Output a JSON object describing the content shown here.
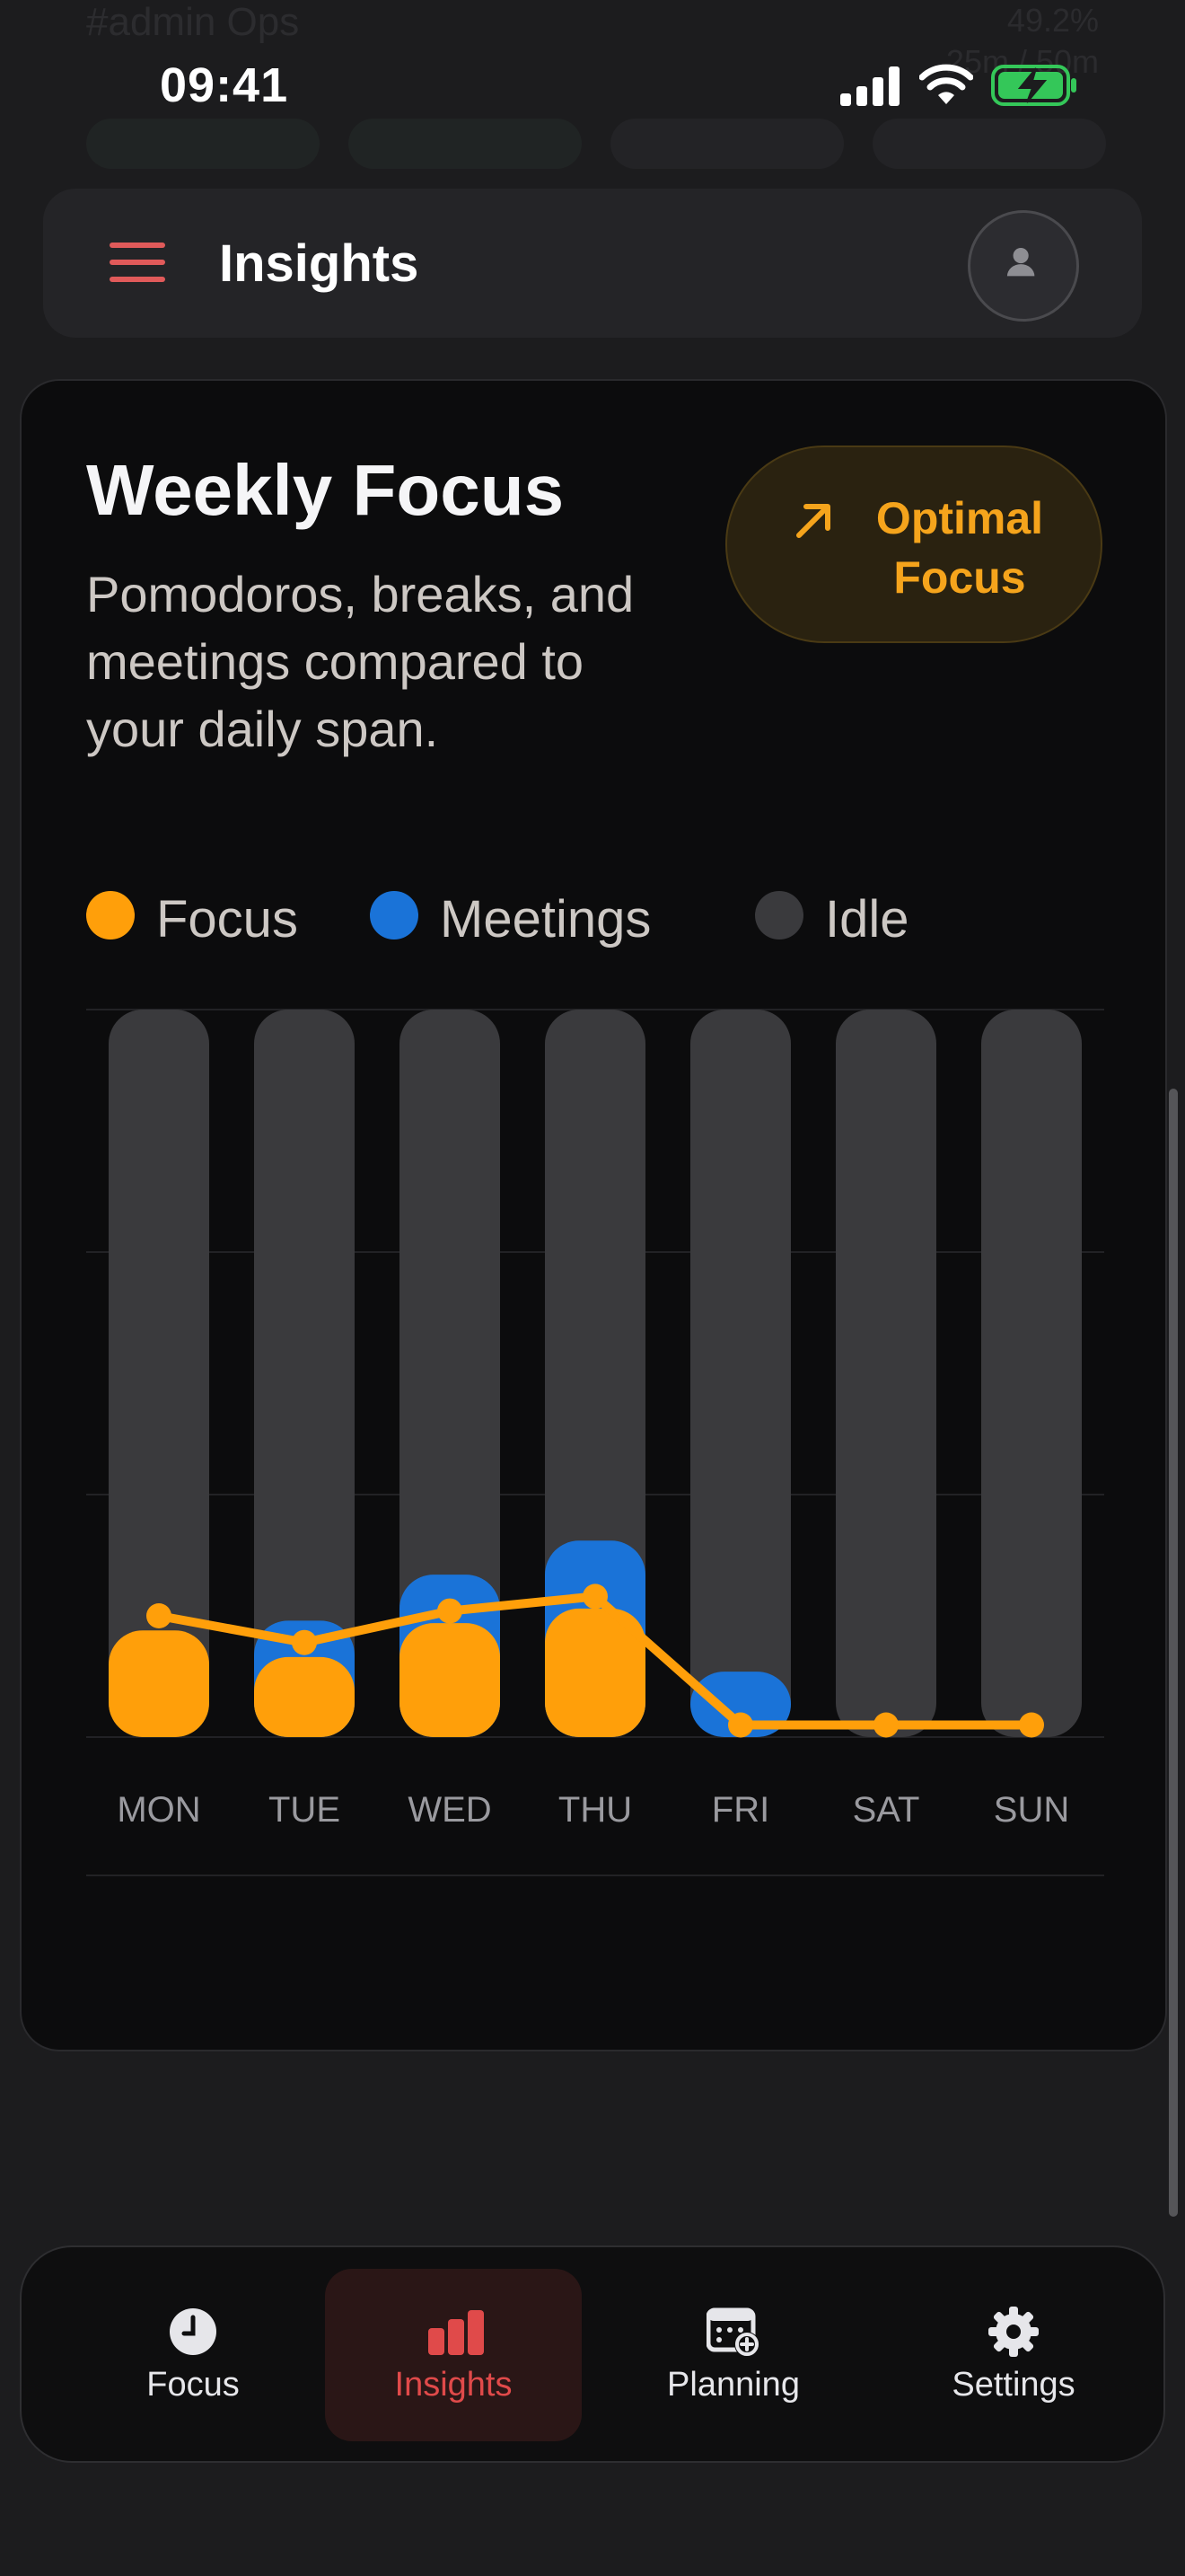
{
  "status_bar": {
    "time": "09:41"
  },
  "ghost": {
    "title": "#admin Ops",
    "meta_top": "49.2%",
    "meta_bottom": "25m / 50m"
  },
  "header": {
    "title": "Insights",
    "menu_icon": "hamburger-icon",
    "avatar_icon": "person-icon"
  },
  "card": {
    "title": "Weekly Focus",
    "subtitle": "Pomodoros, breaks, and meetings compared to your daily span.",
    "action_label": "Optimal Focus",
    "action_icon": "arrow-up-right-icon"
  },
  "legend": [
    {
      "label": "Focus",
      "color": "#ff9f0a"
    },
    {
      "label": "Meetings",
      "color": "#1a73d8"
    },
    {
      "label": "Idle",
      "color": "#3a3a3d"
    }
  ],
  "chart_data": {
    "type": "bar",
    "title": "",
    "categories": [
      "MON",
      "TUE",
      "WED",
      "THU",
      "FRI",
      "SAT",
      "SUN"
    ],
    "stacked": true,
    "ylim": [
      0,
      3
    ],
    "grid": true,
    "legend_position": "top-left",
    "series": [
      {
        "name": "Focus",
        "values": [
          0.44,
          0.33,
          0.47,
          0.53,
          0,
          0,
          0
        ]
      },
      {
        "name": "Meetings",
        "values": [
          0,
          0.15,
          0.2,
          0.28,
          0.27,
          0,
          0
        ]
      },
      {
        "name": "Idle",
        "values": [
          2.56,
          2.52,
          2.33,
          2.19,
          2.73,
          3,
          3
        ]
      }
    ],
    "line": {
      "name": "Focus",
      "values": [
        0.5,
        0.39,
        0.52,
        0.58,
        0.05,
        0.05,
        0.05
      ]
    },
    "colors": {
      "focus": "#ff9f0a",
      "meetings": "#1a73d8",
      "idle": "#3a3a3d",
      "line": "#ff9f0a"
    }
  },
  "nav": [
    {
      "label": "Focus",
      "icon": "clock-icon",
      "active": false
    },
    {
      "label": "Insights",
      "icon": "bar-chart-icon",
      "active": true
    },
    {
      "label": "Planning",
      "icon": "calendar-add-icon",
      "active": false
    },
    {
      "label": "Settings",
      "icon": "gear-icon",
      "active": false
    }
  ],
  "colors": {
    "accent": "#e04a4a",
    "focus": "#ff9f0a",
    "meetings": "#1a73d8"
  }
}
